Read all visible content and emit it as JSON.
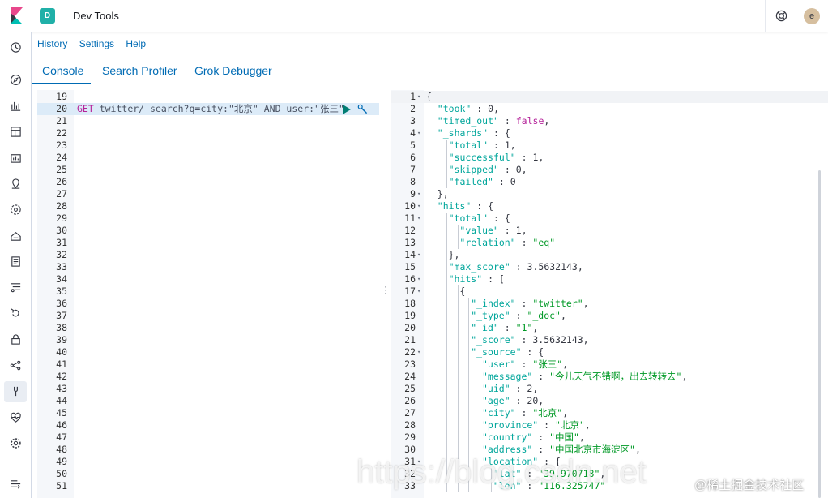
{
  "topbar": {
    "space_initial": "D",
    "app_title": "Dev Tools",
    "avatar_initial": "e"
  },
  "nav_icons": [
    "clock-icon",
    "compass-icon",
    "visualize-icon",
    "dashboard-icon",
    "canvas-icon",
    "maps-icon",
    "ml-icon",
    "infrastructure-icon",
    "logs-icon",
    "apm-icon",
    "uptime-icon",
    "siem-icon",
    "graph-icon",
    "dev-tools-icon",
    "monitoring-icon",
    "management-icon",
    "collapse-icon"
  ],
  "links": {
    "history": "History",
    "settings": "Settings",
    "help": "Help"
  },
  "tabs": [
    {
      "label": "Console",
      "active": true
    },
    {
      "label": "Search Profiler",
      "active": false
    },
    {
      "label": "Grok Debugger",
      "active": false
    }
  ],
  "request": {
    "line_numbers": [
      "19",
      "20",
      "21",
      "22",
      "23",
      "24",
      "25",
      "26",
      "27",
      "28",
      "29",
      "30",
      "31",
      "32",
      "33",
      "34",
      "35",
      "36",
      "37",
      "38",
      "39",
      "40",
      "41",
      "42",
      "43",
      "44",
      "45",
      "46",
      "47",
      "48",
      "49",
      "50",
      "51"
    ],
    "method": "GET",
    "url": " twitter/_search?q=city:\"北京\" AND user:\"张三\""
  },
  "response": {
    "lines": [
      {
        "n": "1",
        "fold": true,
        "indent": 0,
        "text": "{"
      },
      {
        "n": "2",
        "fold": false,
        "indent": 1,
        "key": "\"took\"",
        "val": "0",
        "vt": "n",
        "tail": ","
      },
      {
        "n": "3",
        "fold": false,
        "indent": 1,
        "key": "\"timed_out\"",
        "val": "false",
        "vt": "b",
        "tail": ","
      },
      {
        "n": "4",
        "fold": true,
        "indent": 1,
        "key": "\"_shards\"",
        "val": "{",
        "vt": "p",
        "tail": ""
      },
      {
        "n": "5",
        "fold": false,
        "indent": 2,
        "key": "\"total\"",
        "val": "1",
        "vt": "n",
        "tail": ","
      },
      {
        "n": "6",
        "fold": false,
        "indent": 2,
        "key": "\"successful\"",
        "val": "1",
        "vt": "n",
        "tail": ","
      },
      {
        "n": "7",
        "fold": false,
        "indent": 2,
        "key": "\"skipped\"",
        "val": "0",
        "vt": "n",
        "tail": ","
      },
      {
        "n": "8",
        "fold": false,
        "indent": 2,
        "key": "\"failed\"",
        "val": "0",
        "vt": "n",
        "tail": ""
      },
      {
        "n": "9",
        "fold": true,
        "indent": 1,
        "text": "},"
      },
      {
        "n": "10",
        "fold": true,
        "indent": 1,
        "key": "\"hits\"",
        "val": "{",
        "vt": "p",
        "tail": ""
      },
      {
        "n": "11",
        "fold": true,
        "indent": 2,
        "key": "\"total\"",
        "val": "{",
        "vt": "p",
        "tail": ""
      },
      {
        "n": "12",
        "fold": false,
        "indent": 3,
        "key": "\"value\"",
        "val": "1",
        "vt": "n",
        "tail": ","
      },
      {
        "n": "13",
        "fold": false,
        "indent": 3,
        "key": "\"relation\"",
        "val": "\"eq\"",
        "vt": "s",
        "tail": ""
      },
      {
        "n": "14",
        "fold": true,
        "indent": 2,
        "text": "},"
      },
      {
        "n": "15",
        "fold": false,
        "indent": 2,
        "key": "\"max_score\"",
        "val": "3.5632143",
        "vt": "n",
        "tail": ","
      },
      {
        "n": "16",
        "fold": true,
        "indent": 2,
        "key": "\"hits\"",
        "val": "[",
        "vt": "p",
        "tail": ""
      },
      {
        "n": "17",
        "fold": true,
        "indent": 3,
        "text": "{"
      },
      {
        "n": "18",
        "fold": false,
        "indent": 4,
        "key": "\"_index\"",
        "val": "\"twitter\"",
        "vt": "s",
        "tail": ","
      },
      {
        "n": "19",
        "fold": false,
        "indent": 4,
        "key": "\"_type\"",
        "val": "\"_doc\"",
        "vt": "s",
        "tail": ","
      },
      {
        "n": "20",
        "fold": false,
        "indent": 4,
        "key": "\"_id\"",
        "val": "\"1\"",
        "vt": "s",
        "tail": ","
      },
      {
        "n": "21",
        "fold": false,
        "indent": 4,
        "key": "\"_score\"",
        "val": "3.5632143",
        "vt": "n",
        "tail": ","
      },
      {
        "n": "22",
        "fold": true,
        "indent": 4,
        "key": "\"_source\"",
        "val": "{",
        "vt": "p",
        "tail": ""
      },
      {
        "n": "23",
        "fold": false,
        "indent": 5,
        "key": "\"user\"",
        "val": "\"张三\"",
        "vt": "s",
        "tail": ","
      },
      {
        "n": "24",
        "fold": false,
        "indent": 5,
        "key": "\"message\"",
        "val": "\"今儿天气不错啊，出去转转去\"",
        "vt": "s",
        "tail": ","
      },
      {
        "n": "25",
        "fold": false,
        "indent": 5,
        "key": "\"uid\"",
        "val": "2",
        "vt": "n",
        "tail": ","
      },
      {
        "n": "26",
        "fold": false,
        "indent": 5,
        "key": "\"age\"",
        "val": "20",
        "vt": "n",
        "tail": ","
      },
      {
        "n": "27",
        "fold": false,
        "indent": 5,
        "key": "\"city\"",
        "val": "\"北京\"",
        "vt": "s",
        "tail": ","
      },
      {
        "n": "28",
        "fold": false,
        "indent": 5,
        "key": "\"province\"",
        "val": "\"北京\"",
        "vt": "s",
        "tail": ","
      },
      {
        "n": "29",
        "fold": false,
        "indent": 5,
        "key": "\"country\"",
        "val": "\"中国\"",
        "vt": "s",
        "tail": ","
      },
      {
        "n": "30",
        "fold": false,
        "indent": 5,
        "key": "\"address\"",
        "val": "\"中国北京市海淀区\"",
        "vt": "s",
        "tail": ","
      },
      {
        "n": "31",
        "fold": true,
        "indent": 5,
        "key": "\"location\"",
        "val": "{",
        "vt": "p",
        "tail": ""
      },
      {
        "n": "32",
        "fold": false,
        "indent": 6,
        "key": "\"lat\"",
        "val": "\"39.970718\"",
        "vt": "s",
        "tail": ","
      },
      {
        "n": "33",
        "fold": false,
        "indent": 6,
        "key": "\"lon\"",
        "val": "\"116.325747\"",
        "vt": "s",
        "tail": ""
      }
    ]
  },
  "watermark": {
    "url_text": "https://blog.csdn.net",
    "brand_text": "@稀土掘金技术社区"
  }
}
